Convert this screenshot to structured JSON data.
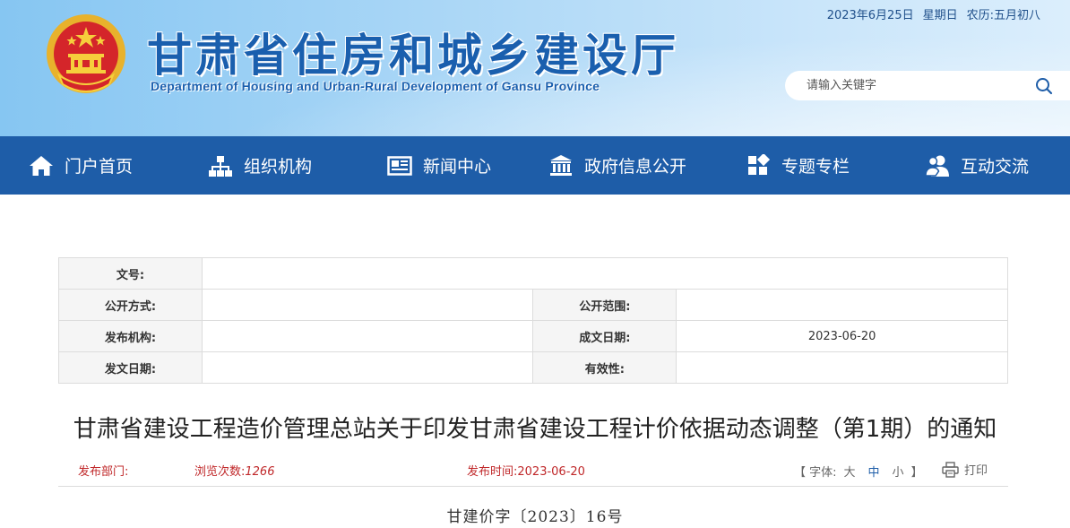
{
  "header": {
    "site_title": "甘肃省住房和城乡建设厅",
    "site_subtitle": "Department of Housing and Urban-Rural Development of Gansu Province",
    "date": "2023年6月25日",
    "weekday": "星期日",
    "lunar": "农历:五月初八",
    "search_placeholder": "请输入关键字",
    "emblem_icon": "national-emblem-icon",
    "colors": {
      "title": "#1a5fae",
      "banner": "#a9d6f6"
    }
  },
  "nav": {
    "background": "#1e5da8",
    "items": [
      {
        "label": "门户首页",
        "icon": "home-icon"
      },
      {
        "label": "组织机构",
        "icon": "org-chart-icon"
      },
      {
        "label": "新闻中心",
        "icon": "newspaper-icon"
      },
      {
        "label": "政府信息公开",
        "icon": "government-building-icon"
      },
      {
        "label": "专题专栏",
        "icon": "grid-icon"
      },
      {
        "label": "互动交流",
        "icon": "users-icon"
      }
    ]
  },
  "info": {
    "doc_no_label": "文号:",
    "doc_no_value": "",
    "disclosure_method_label": "公开方式:",
    "disclosure_method_value": "",
    "disclosure_scope_label": "公开范围:",
    "disclosure_scope_value": "",
    "issuer_label": "发布机构:",
    "issuer_value": "",
    "created_date_label": "成文日期:",
    "created_date_value": "2023-06-20",
    "issue_date_label": "发文日期:",
    "issue_date_value": "",
    "validity_label": "有效性:",
    "validity_value": ""
  },
  "article": {
    "title": "甘肃省建设工程造价管理总站关于印发甘肃省建设工程计价依据动态调整（第1期）的通知",
    "department_label": "发布部门:",
    "department_value": "",
    "views_label": "浏览次数:",
    "views_value": "1266",
    "publish_time_label": "发布时间:",
    "publish_time_value": "2023-06-20",
    "font_size_open": "【 字体:",
    "font_large": "大",
    "font_medium": "中",
    "font_small": "小",
    "font_size_close": "】",
    "print_label": "打印",
    "doc_number": "甘建价字〔2023〕16号",
    "meta_color": "#c0282a"
  }
}
